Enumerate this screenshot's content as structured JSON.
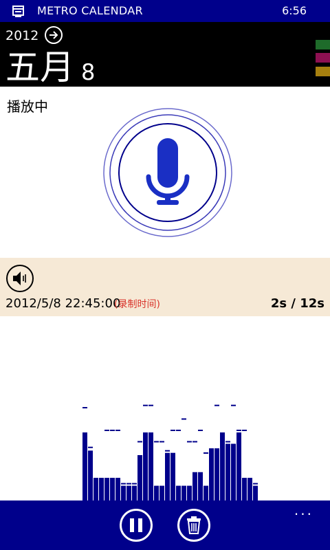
{
  "status_bar": {
    "app_title": "METRO CALENDAR",
    "time": "6:56"
  },
  "header": {
    "year": "2012",
    "month": "五月",
    "day": "8",
    "category_colors": [
      "#1e6b2a",
      "#8e1052",
      "#a7800f"
    ]
  },
  "player": {
    "state_label": "播放中"
  },
  "recording": {
    "datetime": "2012/5/8 22:45:00",
    "datetime_note": "(录制时间)",
    "progress": "2s / 12s",
    "elapsed_seconds": 2,
    "total_seconds": 12
  },
  "visualizer": {
    "bars": [
      60,
      44,
      20,
      20,
      20,
      20,
      20,
      13,
      13,
      13,
      40,
      60,
      60,
      13,
      13,
      42,
      42,
      13,
      13,
      13,
      25,
      25,
      13,
      46,
      46,
      60,
      50,
      50,
      60,
      20,
      20,
      13
    ],
    "peaks": [
      80,
      45,
      13,
      13,
      60,
      60,
      60,
      13,
      13,
      13,
      50,
      82,
      82,
      50,
      50,
      42,
      60,
      60,
      70,
      50,
      50,
      60,
      40,
      40,
      82,
      50,
      50,
      82,
      60,
      60,
      13,
      13
    ],
    "color": "#00008b"
  },
  "app_bar": {
    "more_label": "...",
    "buttons": [
      {
        "name": "pause"
      },
      {
        "name": "delete"
      }
    ]
  },
  "colors": {
    "accent": "#00008b",
    "mic": "#1a2fc4",
    "panel": "#f6e9d6",
    "note": "#d9342b"
  }
}
